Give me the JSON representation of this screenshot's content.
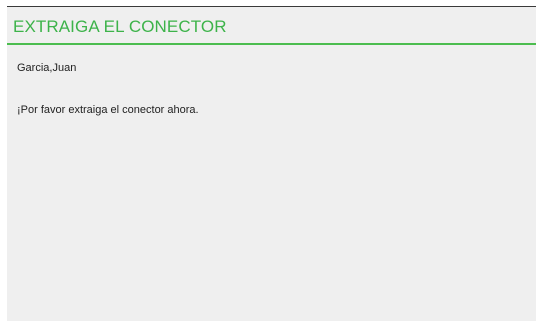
{
  "header": {
    "title": "EXTRAIGA EL CONECTOR",
    "accent_color": "#4cbd4f"
  },
  "content": {
    "name": "Garcia,Juan",
    "message": "¡Por favor extraiga el conector ahora."
  }
}
